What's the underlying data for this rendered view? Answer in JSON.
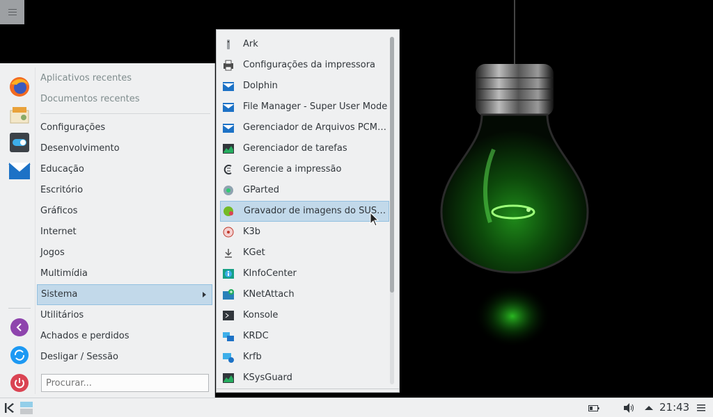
{
  "launcher": {
    "recent": [
      "Aplicativos recentes",
      "Documentos recentes"
    ],
    "categories": [
      "Configurações",
      "Desenvolvimento",
      "Educação",
      "Escritório",
      "Gráficos",
      "Internet",
      "Jogos",
      "Multimídia",
      "Sistema",
      "Utilitários",
      "Achados e perdidos",
      "Desligar / Sessão"
    ],
    "active_category": "Sistema",
    "search_placeholder": "Procurar...",
    "favorites": [
      "firefox-icon",
      "installer-icon",
      "settings-toggle-icon",
      "mail-icon"
    ],
    "session_icons": [
      "back-icon",
      "switch-user-icon",
      "power-icon"
    ]
  },
  "submenu": {
    "items": [
      "Ark",
      "Configurações da impressora",
      "Dolphin",
      "File Manager - Super User Mode",
      "Gerenciador de Arquivos PCManFM",
      "Gerenciador de tarefas",
      "Gerencie a impressão",
      "GParted",
      "Gravador de imagens do SUSE Studio",
      "K3b",
      "KGet",
      "KInfoCenter",
      "KNetAttach",
      "Konsole",
      "KRDC",
      "Krfb",
      "KSysGuard"
    ],
    "hovered": "Gravador de imagens do SUSE Studio"
  },
  "panel": {
    "clock": "21:43"
  },
  "colors": {
    "menu_bg": "#eff0f1",
    "highlight": "#c2d9ea",
    "highlight_border": "#93c0e0",
    "bulb_glow": "#39d22c"
  }
}
